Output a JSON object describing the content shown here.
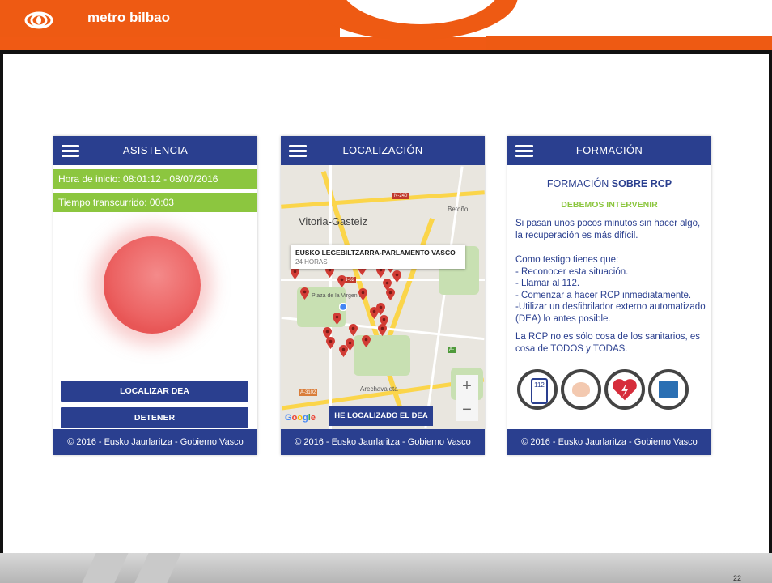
{
  "header": {
    "brand": "metro bilbao",
    "colors": {
      "orange": "#ee5a13",
      "dark_line": "#111111"
    }
  },
  "page_number": "22",
  "app_colors": {
    "appbar": "#2a3f8f",
    "green": "#8cc63f",
    "alert": "#ec6363"
  },
  "asistencia": {
    "title": "ASISTENCIA",
    "start_time": "Hora de inicio: 08:01:12 - 08/07/2016",
    "elapsed": "Tiempo transcurrido: 00:03",
    "locate_button": "LOCALIZAR DEA",
    "stop_button": "DETENER",
    "footer": "© 2016 - Eusko Jaurlaritza - Gobierno Vasco"
  },
  "localizacion": {
    "title": "LOCALIZACIÓN",
    "city": "Vitoria-Gasteiz",
    "labels": {
      "betono": "Betoño",
      "arechavaleta": "Arechavaleta",
      "plaza": "Plaza de la Virgen Blanca"
    },
    "road_tags": {
      "n240": "N-240",
      "n622": "N-62",
      "a3102": "A-3102",
      "a": "A-"
    },
    "popup_title": "EUSKO LEGEBILTZARRA-PARLAMENTO VASCO",
    "popup_subtitle": "24 HORAS",
    "zoom_in": "+",
    "zoom_out": "−",
    "google": "Google",
    "found_button": "HE LOCALIZADO EL DEA",
    "footer": "© 2016 - Eusko Jaurlaritza - Gobierno Vasco"
  },
  "formacion": {
    "title": "FORMACIÓN",
    "heading_prefix": "FORMACIÓN",
    "heading_bold": "SOBRE RCP",
    "subheading": "DEBEMOS INTERVENIR",
    "para1": "Si pasan unos pocos minutos sin hacer algo, la recuperación es más difícil.",
    "witness_intro": "Como testigo tienes que:",
    "steps": [
      "- Reconocer esta situación.",
      "- Llamar al 112.",
      "- Comenzar a hacer RCP inmediatamente.",
      "-Utilizar un desfibrilador externo automatizado (DEA) lo antes posible."
    ],
    "para2": "La RCP no es sólo cosa de los sanitarios, es cosa de TODOS y TODAS.",
    "phone_number": "112",
    "footer": "© 2016 - Eusko Jaurlaritza - Gobierno Vasco"
  }
}
